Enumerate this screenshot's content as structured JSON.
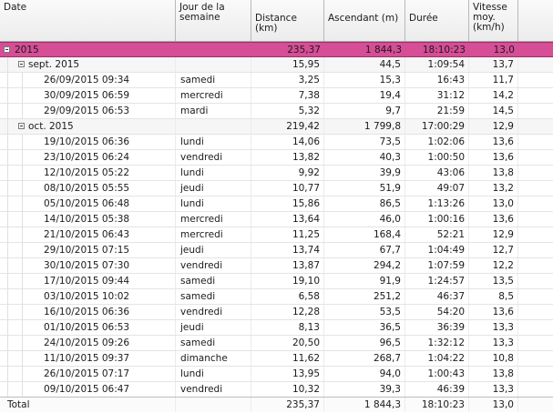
{
  "columns": {
    "date": "Date",
    "weekday_l1": "Jour de la",
    "weekday_l2": "semaine",
    "distance": "Distance (km)",
    "ascent": "Ascendant (m)",
    "duration": "Durée",
    "speed_l1": "Vitesse",
    "speed_l2": "moy.",
    "speed_l3": "(km/h)"
  },
  "year_group": {
    "label": "2015",
    "distance": "235,37",
    "ascent": "1 844,3",
    "duration": "18:10:23",
    "speed": "13,0"
  },
  "months": [
    {
      "label": "sept. 2015",
      "distance": "15,95",
      "ascent": "44,5",
      "duration": "1:09:54",
      "speed": "13,7",
      "rows": [
        {
          "date": "26/09/2015 09:34",
          "weekday": "samedi",
          "distance": "3,25",
          "ascent": "15,3",
          "duration": "16:43",
          "speed": "11,7"
        },
        {
          "date": "30/09/2015 06:59",
          "weekday": "mercredi",
          "distance": "7,38",
          "ascent": "19,4",
          "duration": "31:12",
          "speed": "14,2"
        },
        {
          "date": "29/09/2015 06:53",
          "weekday": "mardi",
          "distance": "5,32",
          "ascent": "9,7",
          "duration": "21:59",
          "speed": "14,5"
        }
      ]
    },
    {
      "label": "oct. 2015",
      "distance": "219,42",
      "ascent": "1 799,8",
      "duration": "17:00:29",
      "speed": "12,9",
      "rows": [
        {
          "date": "19/10/2015 06:36",
          "weekday": "lundi",
          "distance": "14,06",
          "ascent": "73,5",
          "duration": "1:02:06",
          "speed": "13,6"
        },
        {
          "date": "23/10/2015 06:24",
          "weekday": "vendredi",
          "distance": "13,82",
          "ascent": "40,3",
          "duration": "1:00:50",
          "speed": "13,6"
        },
        {
          "date": "12/10/2015 05:22",
          "weekday": "lundi",
          "distance": "9,92",
          "ascent": "39,9",
          "duration": "43:06",
          "speed": "13,8"
        },
        {
          "date": "08/10/2015 05:55",
          "weekday": "jeudi",
          "distance": "10,77",
          "ascent": "51,9",
          "duration": "49:07",
          "speed": "13,2"
        },
        {
          "date": "05/10/2015 06:48",
          "weekday": "lundi",
          "distance": "15,86",
          "ascent": "86,5",
          "duration": "1:13:26",
          "speed": "13,0"
        },
        {
          "date": "14/10/2015 05:38",
          "weekday": "mercredi",
          "distance": "13,64",
          "ascent": "46,0",
          "duration": "1:00:16",
          "speed": "13,6"
        },
        {
          "date": "21/10/2015 06:43",
          "weekday": "mercredi",
          "distance": "11,25",
          "ascent": "168,4",
          "duration": "52:21",
          "speed": "12,9"
        },
        {
          "date": "29/10/2015 07:15",
          "weekday": "jeudi",
          "distance": "13,74",
          "ascent": "67,7",
          "duration": "1:04:49",
          "speed": "12,7"
        },
        {
          "date": "30/10/2015 07:30",
          "weekday": "vendredi",
          "distance": "13,87",
          "ascent": "294,2",
          "duration": "1:07:59",
          "speed": "12,2"
        },
        {
          "date": "17/10/2015 09:44",
          "weekday": "samedi",
          "distance": "19,10",
          "ascent": "91,9",
          "duration": "1:24:57",
          "speed": "13,5"
        },
        {
          "date": "03/10/2015 10:02",
          "weekday": "samedi",
          "distance": "6,58",
          "ascent": "251,2",
          "duration": "46:37",
          "speed": "8,5"
        },
        {
          "date": "16/10/2015 06:36",
          "weekday": "vendredi",
          "distance": "12,28",
          "ascent": "53,5",
          "duration": "54:20",
          "speed": "13,6"
        },
        {
          "date": "01/10/2015 06:53",
          "weekday": "jeudi",
          "distance": "8,13",
          "ascent": "36,5",
          "duration": "36:39",
          "speed": "13,3"
        },
        {
          "date": "24/10/2015 09:26",
          "weekday": "samedi",
          "distance": "20,50",
          "ascent": "96,5",
          "duration": "1:32:12",
          "speed": "13,3"
        },
        {
          "date": "11/10/2015 09:37",
          "weekday": "dimanche",
          "distance": "11,62",
          "ascent": "268,7",
          "duration": "1:04:22",
          "speed": "10,8"
        },
        {
          "date": "26/10/2015 07:17",
          "weekday": "lundi",
          "distance": "13,95",
          "ascent": "94,0",
          "duration": "1:00:43",
          "speed": "13,8"
        },
        {
          "date": "09/10/2015 06:47",
          "weekday": "vendredi",
          "distance": "10,32",
          "ascent": "39,3",
          "duration": "46:39",
          "speed": "13,3"
        }
      ]
    }
  ],
  "total": {
    "label": "Total",
    "distance": "235,37",
    "ascent": "1 844,3",
    "duration": "18:10:23",
    "speed": "13,0"
  },
  "colors": {
    "year_row": "#d54e96",
    "header": "#ececec",
    "grid_line": "#e4e4e4"
  },
  "icons": {
    "collapse": "minus-box-icon"
  }
}
